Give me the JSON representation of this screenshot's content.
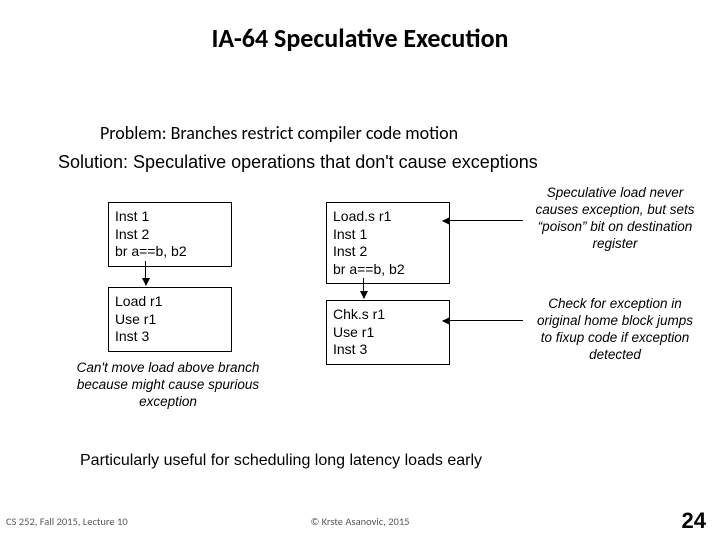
{
  "title": "IA-64 Speculative Execution",
  "problem": "Problem: Branches restrict compiler code motion",
  "solution": "Solution: Speculative operations that don't cause exceptions",
  "leftBox1": "Inst 1\nInst 2\nbr a==b, b2",
  "leftBox2": "Load r1\nUse r1\nInst 3",
  "leftCaption": "Can't move load above branch\nbecause might cause spurious\nexception",
  "rightBox1": "Load.s r1\nInst 1\nInst 2\nbr a==b, b2",
  "rightBox2": "Chk.s r1\nUse r1\nInst 3",
  "rightCaption1": "Speculative load\nnever causes\nexception, but sets\n“poison” bit on\ndestination register",
  "rightCaption2": "Check for exception in\noriginal home block\njumps to fixup code if\nexception detected",
  "conclusion": "Particularly useful for scheduling long latency loads early",
  "footerLeft": "CS 252, Fall 2015, Lecture 10",
  "footerCenter": "© Krste Asanovic, 2015",
  "pageNumber": "24"
}
